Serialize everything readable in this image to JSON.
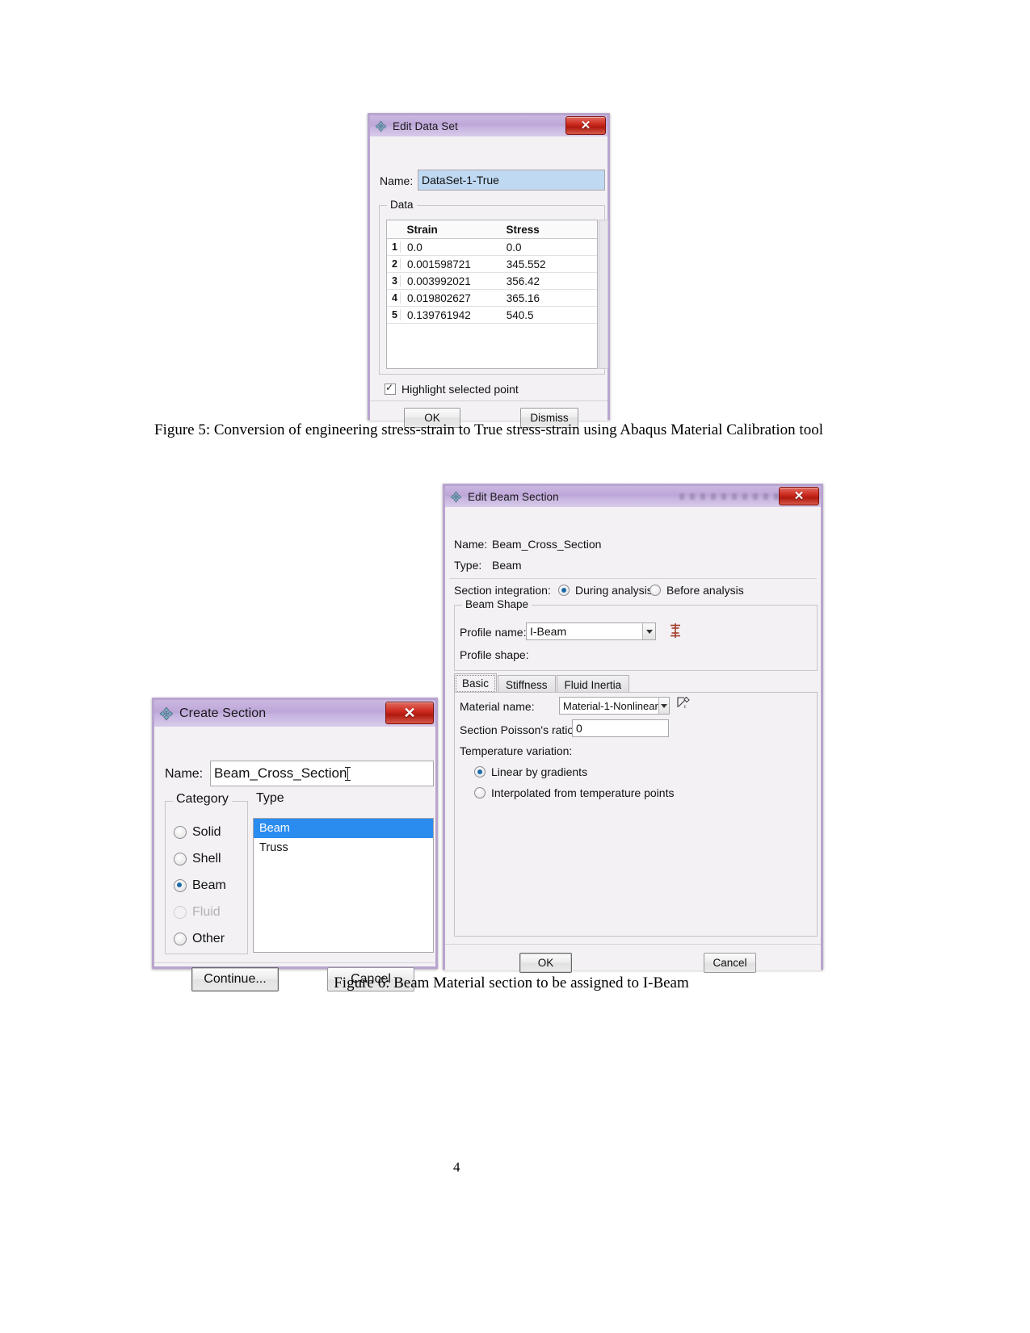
{
  "page": {
    "number": "4"
  },
  "figure5": {
    "caption_line1": "Figure 5: Conversion of engineering stress-strain to True stress-strain using Abaqus Material",
    "caption_line2": "Calibration tool"
  },
  "figure6": {
    "caption": "Figure 6: Beam Material section to be assigned to I-Beam"
  },
  "edit_data_set_dialog": {
    "title": "Edit Data Set",
    "close_label": "✕",
    "name_label": "Name:",
    "name_value": "DataSet-1-True",
    "data_group_title": "Data",
    "table": {
      "columns": [
        "Strain",
        "Stress"
      ],
      "rows": [
        {
          "index": "1",
          "strain": "0.0",
          "stress": "0.0"
        },
        {
          "index": "2",
          "strain": "0.001598721",
          "stress": "345.552"
        },
        {
          "index": "3",
          "strain": "0.003992021",
          "stress": "356.42"
        },
        {
          "index": "4",
          "strain": "0.019802627",
          "stress": "365.16"
        },
        {
          "index": "5",
          "strain": "0.139761942",
          "stress": "540.5"
        }
      ]
    },
    "highlight_checkbox_label": "Highlight selected point",
    "highlight_checked": true,
    "ok_label": "OK",
    "dismiss_label": "Dismiss"
  },
  "edit_beam_section_dialog": {
    "title": "Edit Beam Section",
    "close_label": "✕",
    "name_label": "Name:",
    "name_value": "Beam_Cross_Section",
    "type_label": "Type:",
    "type_value": "Beam",
    "section_integration_label": "Section integration:",
    "integration_options": [
      {
        "label": "During analysis",
        "selected": true
      },
      {
        "label": "Before analysis",
        "selected": false
      }
    ],
    "beam_shape_group_title": "Beam Shape",
    "profile_name_label": "Profile name:",
    "profile_name_value": "I-Beam",
    "profile_shape_label": "Profile shape:",
    "tabs": [
      {
        "label": "Basic",
        "active": true
      },
      {
        "label": "Stiffness",
        "active": false
      },
      {
        "label": "Fluid Inertia",
        "active": false
      }
    ],
    "material_name_label": "Material name:",
    "material_name_value": "Material-1-Nonlinear",
    "poisson_label": "Section Poisson's ratio:",
    "poisson_value": "0",
    "temperature_variation_label": "Temperature variation:",
    "temperature_options": [
      {
        "label": "Linear by gradients",
        "selected": true
      },
      {
        "label": "Interpolated from temperature points",
        "selected": false
      }
    ],
    "ok_label": "OK",
    "cancel_label": "Cancel"
  },
  "create_section_dialog": {
    "title": "Create Section",
    "close_label": "✕",
    "name_label": "Name:",
    "name_value": "Beam_Cross_Section",
    "category_group_title": "Category",
    "categories": [
      {
        "label": "Solid",
        "selected": false,
        "disabled": false
      },
      {
        "label": "Shell",
        "selected": false,
        "disabled": false
      },
      {
        "label": "Beam",
        "selected": true,
        "disabled": false
      },
      {
        "label": "Fluid",
        "selected": false,
        "disabled": true
      },
      {
        "label": "Other",
        "selected": false,
        "disabled": false
      }
    ],
    "type_group_title": "Type",
    "types": [
      {
        "label": "Beam",
        "selected": true
      },
      {
        "label": "Truss",
        "selected": false
      }
    ],
    "continue_label": "Continue...",
    "cancel_label": "Cancel"
  }
}
